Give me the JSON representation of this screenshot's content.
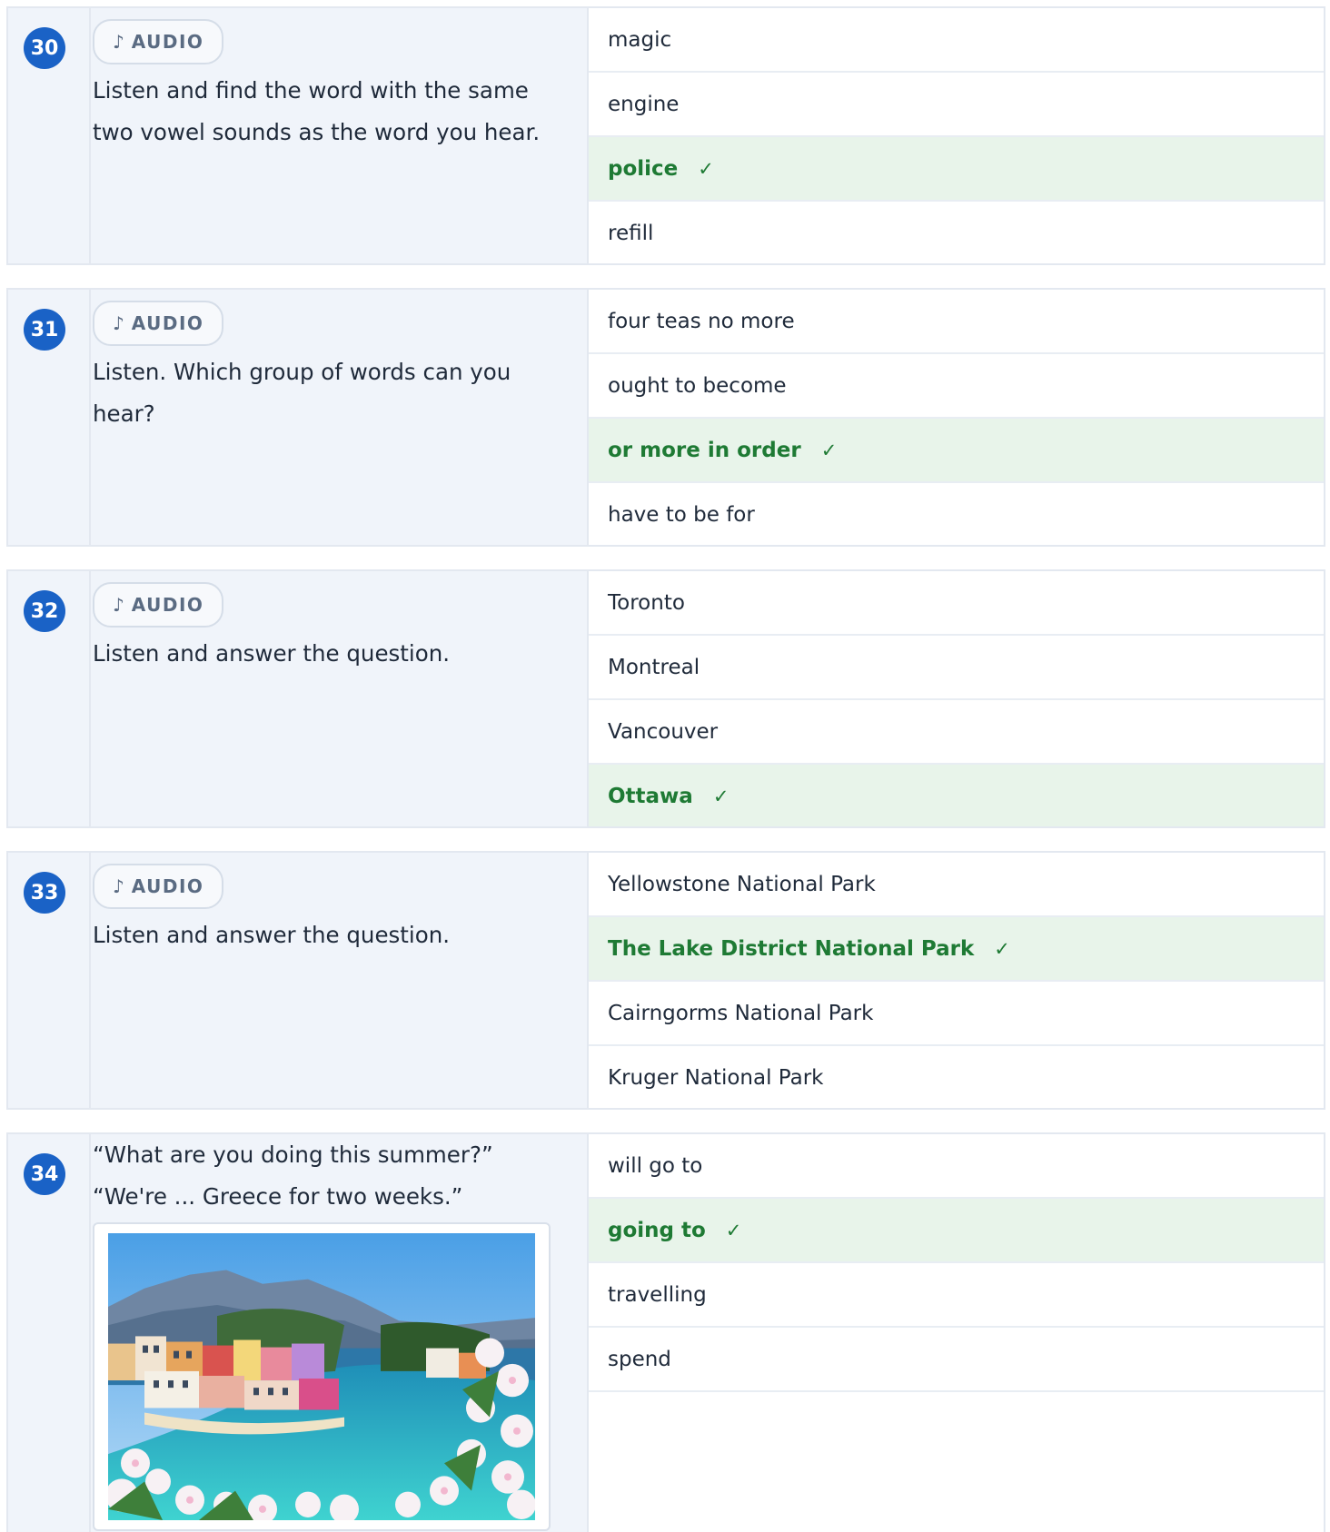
{
  "audio_label": "AUDIO",
  "audio_icon": "music-note-icon",
  "check_mark": "✓",
  "colors": {
    "badge": "#1a62c6",
    "correct_bg": "#e8f4ea",
    "correct_text": "#1e7a34",
    "question_bg": "#f0f4fa"
  },
  "questions": [
    {
      "number": "30",
      "prompt": "Listen and find the word with the same two vowel sounds as the word you hear.",
      "options": [
        {
          "text": "magic",
          "correct": false
        },
        {
          "text": "engine",
          "correct": false
        },
        {
          "text": "police",
          "correct": true
        },
        {
          "text": "refill",
          "correct": false
        }
      ]
    },
    {
      "number": "31",
      "prompt": "Listen. Which group of words can you hear?",
      "options": [
        {
          "text": "four teas no more",
          "correct": false
        },
        {
          "text": "ought to become",
          "correct": false
        },
        {
          "text": "or more in order",
          "correct": true
        },
        {
          "text": "have to be for",
          "correct": false
        }
      ]
    },
    {
      "number": "32",
      "prompt": "Listen and answer the question.",
      "options": [
        {
          "text": "Toronto",
          "correct": false
        },
        {
          "text": "Montreal",
          "correct": false
        },
        {
          "text": "Vancouver",
          "correct": false
        },
        {
          "text": "Ottawa",
          "correct": true
        }
      ]
    },
    {
      "number": "33",
      "prompt": "Listen and answer the question.",
      "options": [
        {
          "text": "Yellowstone National Park",
          "correct": false
        },
        {
          "text": "The Lake District National Park",
          "correct": true
        },
        {
          "text": "Cairngorms National Park",
          "correct": false
        },
        {
          "text": "Kruger National Park",
          "correct": false
        }
      ]
    },
    {
      "number": "34",
      "prompt_line1": "“What are you doing this summer?”",
      "prompt_line2": "“We're ... Greece for two weeks.”",
      "image": "greek-coastal-village-photo",
      "options": [
        {
          "text": "will go to",
          "correct": false
        },
        {
          "text": "going to",
          "correct": true
        },
        {
          "text": "travelling",
          "correct": false
        },
        {
          "text": "spend",
          "correct": false
        }
      ]
    }
  ]
}
